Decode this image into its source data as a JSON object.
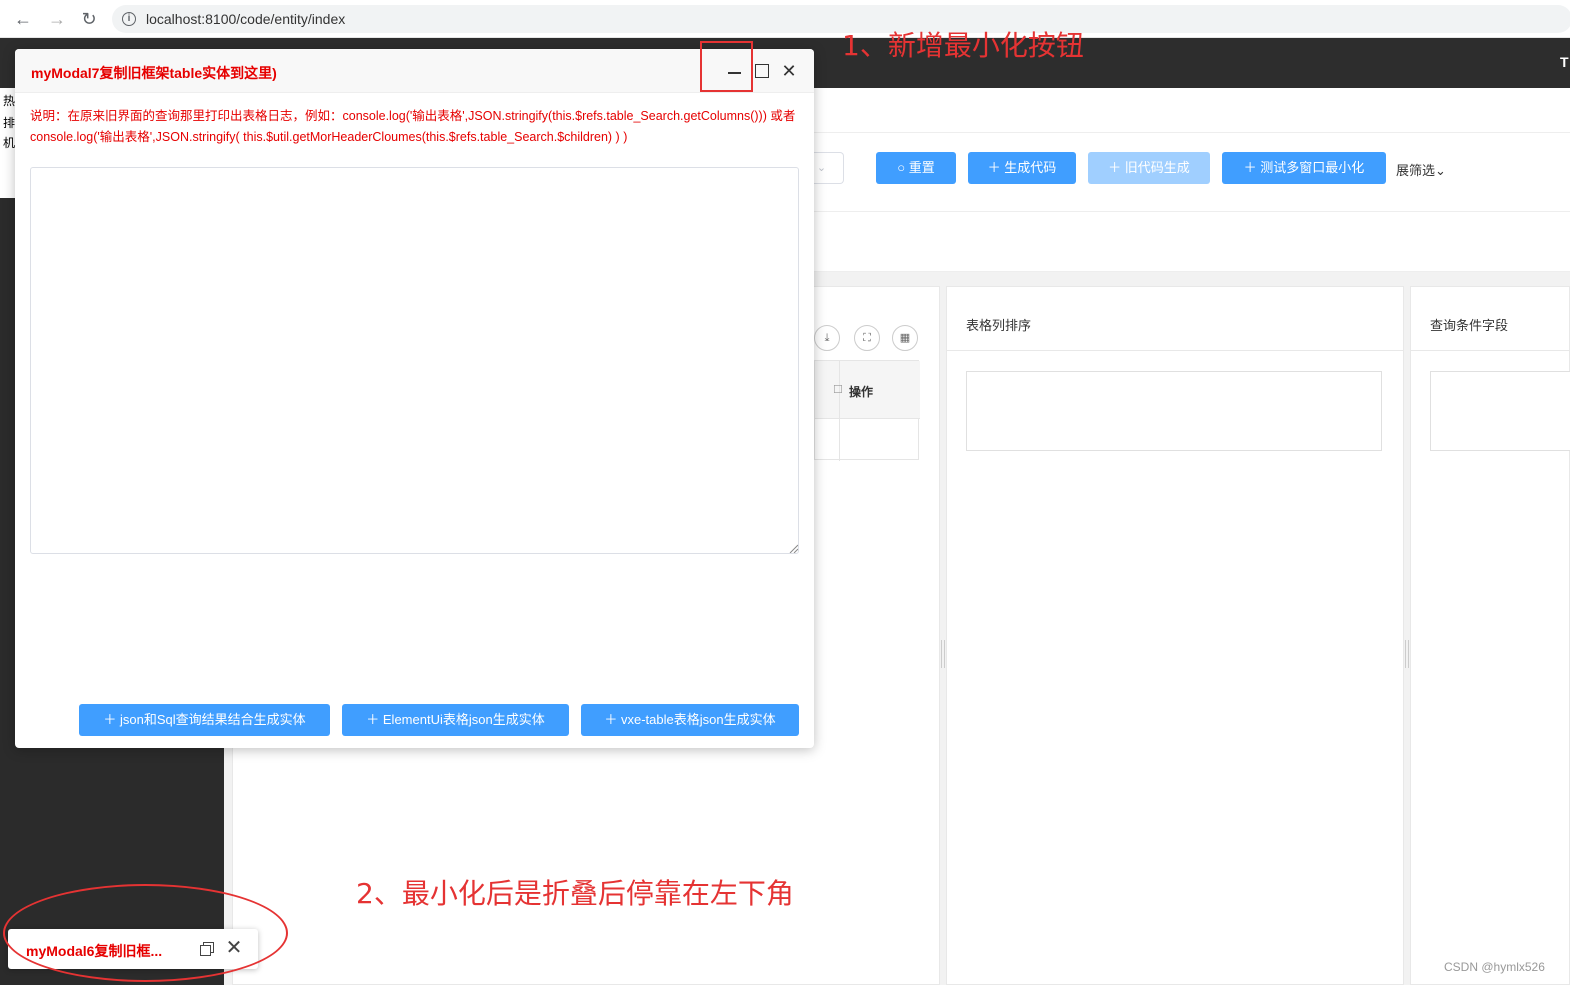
{
  "browser": {
    "url": "localhost:8100/code/entity/index",
    "back_icon": "←",
    "forward_icon": "→",
    "reload_icon": "↻",
    "info_icon": "i"
  },
  "header": {
    "corner_text": "T"
  },
  "sidebar": {
    "chars": [
      "热",
      "排",
      "机"
    ]
  },
  "toolbar": {
    "reset_label": "重置",
    "generate_label": "生成代码",
    "old_generate_label": "旧代码生成",
    "test_minimize_label": "测试多窗口最小化",
    "expand_filter_label": "展筛选",
    "select_chevron": "⌄"
  },
  "panels": {
    "table_sort_title": "表格列排序",
    "query_fields_title": "查询条件字段",
    "operation_header": "操作"
  },
  "modal": {
    "title": "myModal7复制旧框架table实体到这里)",
    "description": "说明：在原来旧界面的查询那里打印出表格日志，例如：console.log('输出表格',JSON.stringify(this.$refs.table_Search.getColumns())) 或者 console.log('输出表格',JSON.stringify( this.$util.getMorHeaderCloumes(this.$refs.table_Search.$children) ) )",
    "textarea_value": "",
    "close_icon": "✕",
    "buttons": {
      "json_sql": "json和Sql查询结果结合生成实体",
      "element_ui": "ElementUi表格json生成实体",
      "vxe_table": "vxe-table表格json生成实体"
    }
  },
  "dock": {
    "title": "myModal6复制旧框...",
    "close_icon": "✕"
  },
  "annotations": {
    "first": "1、新增最小化按钮",
    "second": "2、最小化后是折叠后停靠在左下角"
  },
  "watermark": "CSDN @hymlx526",
  "colors": {
    "primary": "#409eff",
    "primary_disabled": "#a0cfff",
    "title_red": "#e60000",
    "annotation_red": "#e53333",
    "dark_header": "#2d2d2d"
  }
}
